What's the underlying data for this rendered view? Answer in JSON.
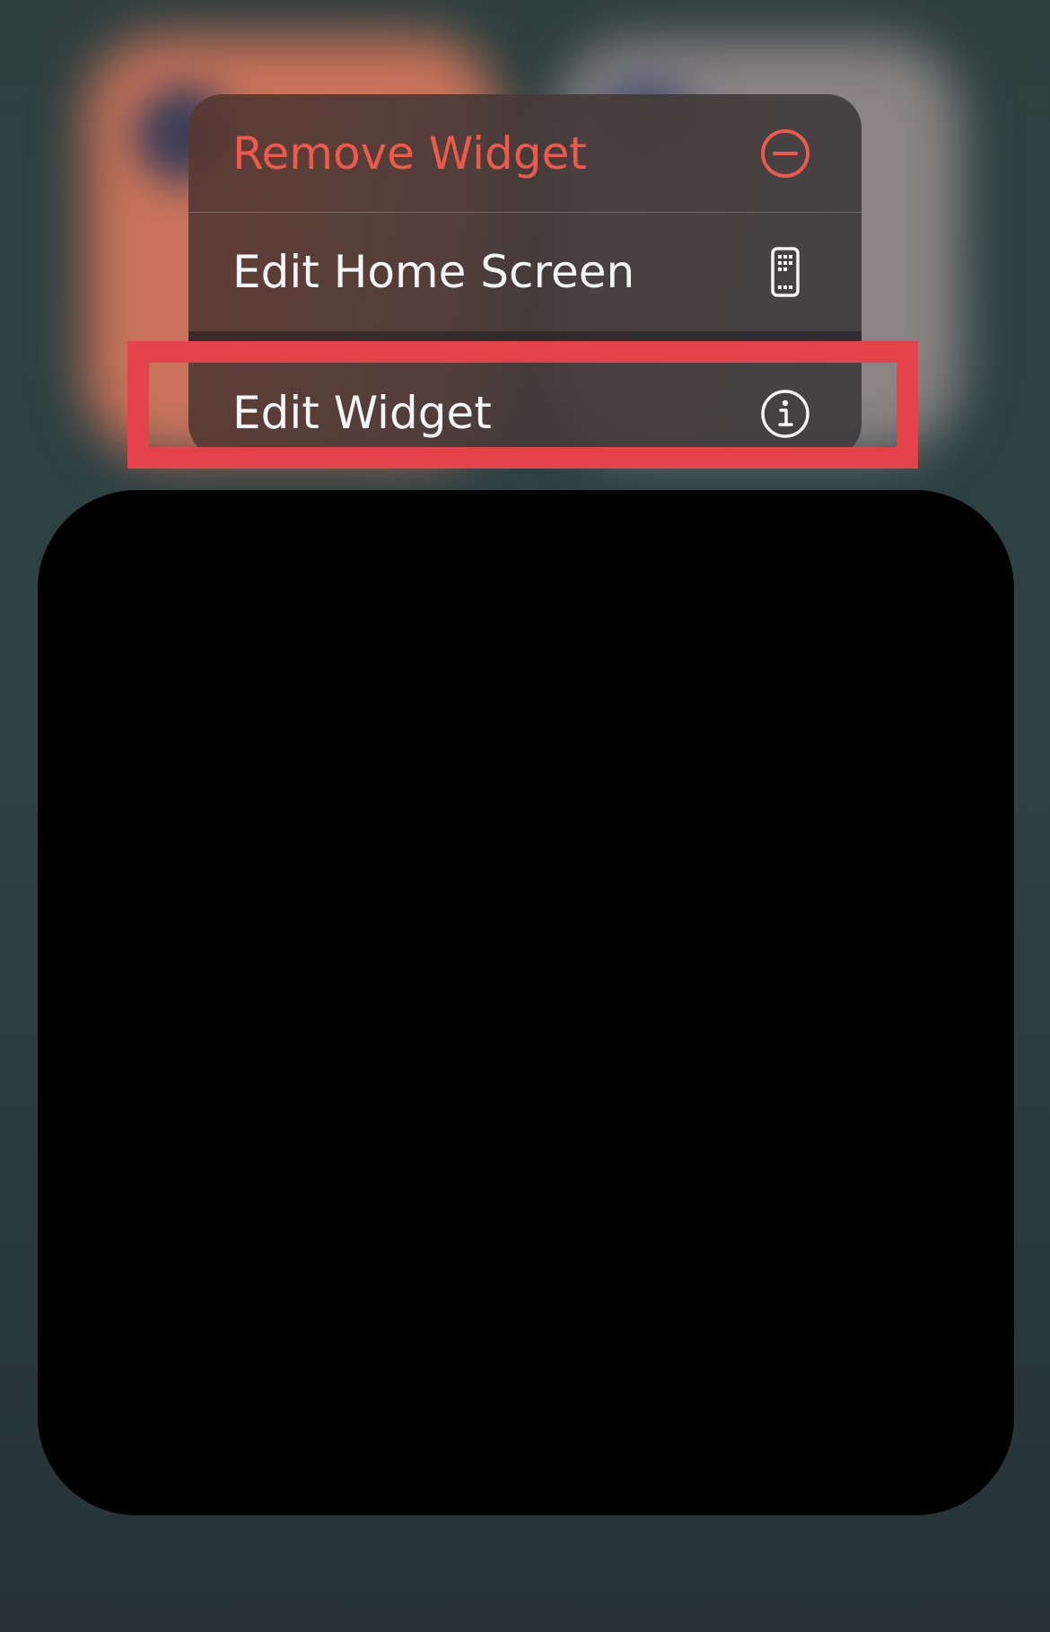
{
  "menu": {
    "remove_widget_label": "Remove Widget",
    "edit_home_screen_label": "Edit Home Screen",
    "edit_widget_label": "Edit Widget"
  },
  "icons": {
    "remove": "minus-circle-icon",
    "edit_home": "phone-grid-icon",
    "edit_widget": "info-circle-icon"
  },
  "colors": {
    "destructive": "#ec5a4c",
    "highlight": "#e5434c",
    "text": "#f5f5f5"
  }
}
